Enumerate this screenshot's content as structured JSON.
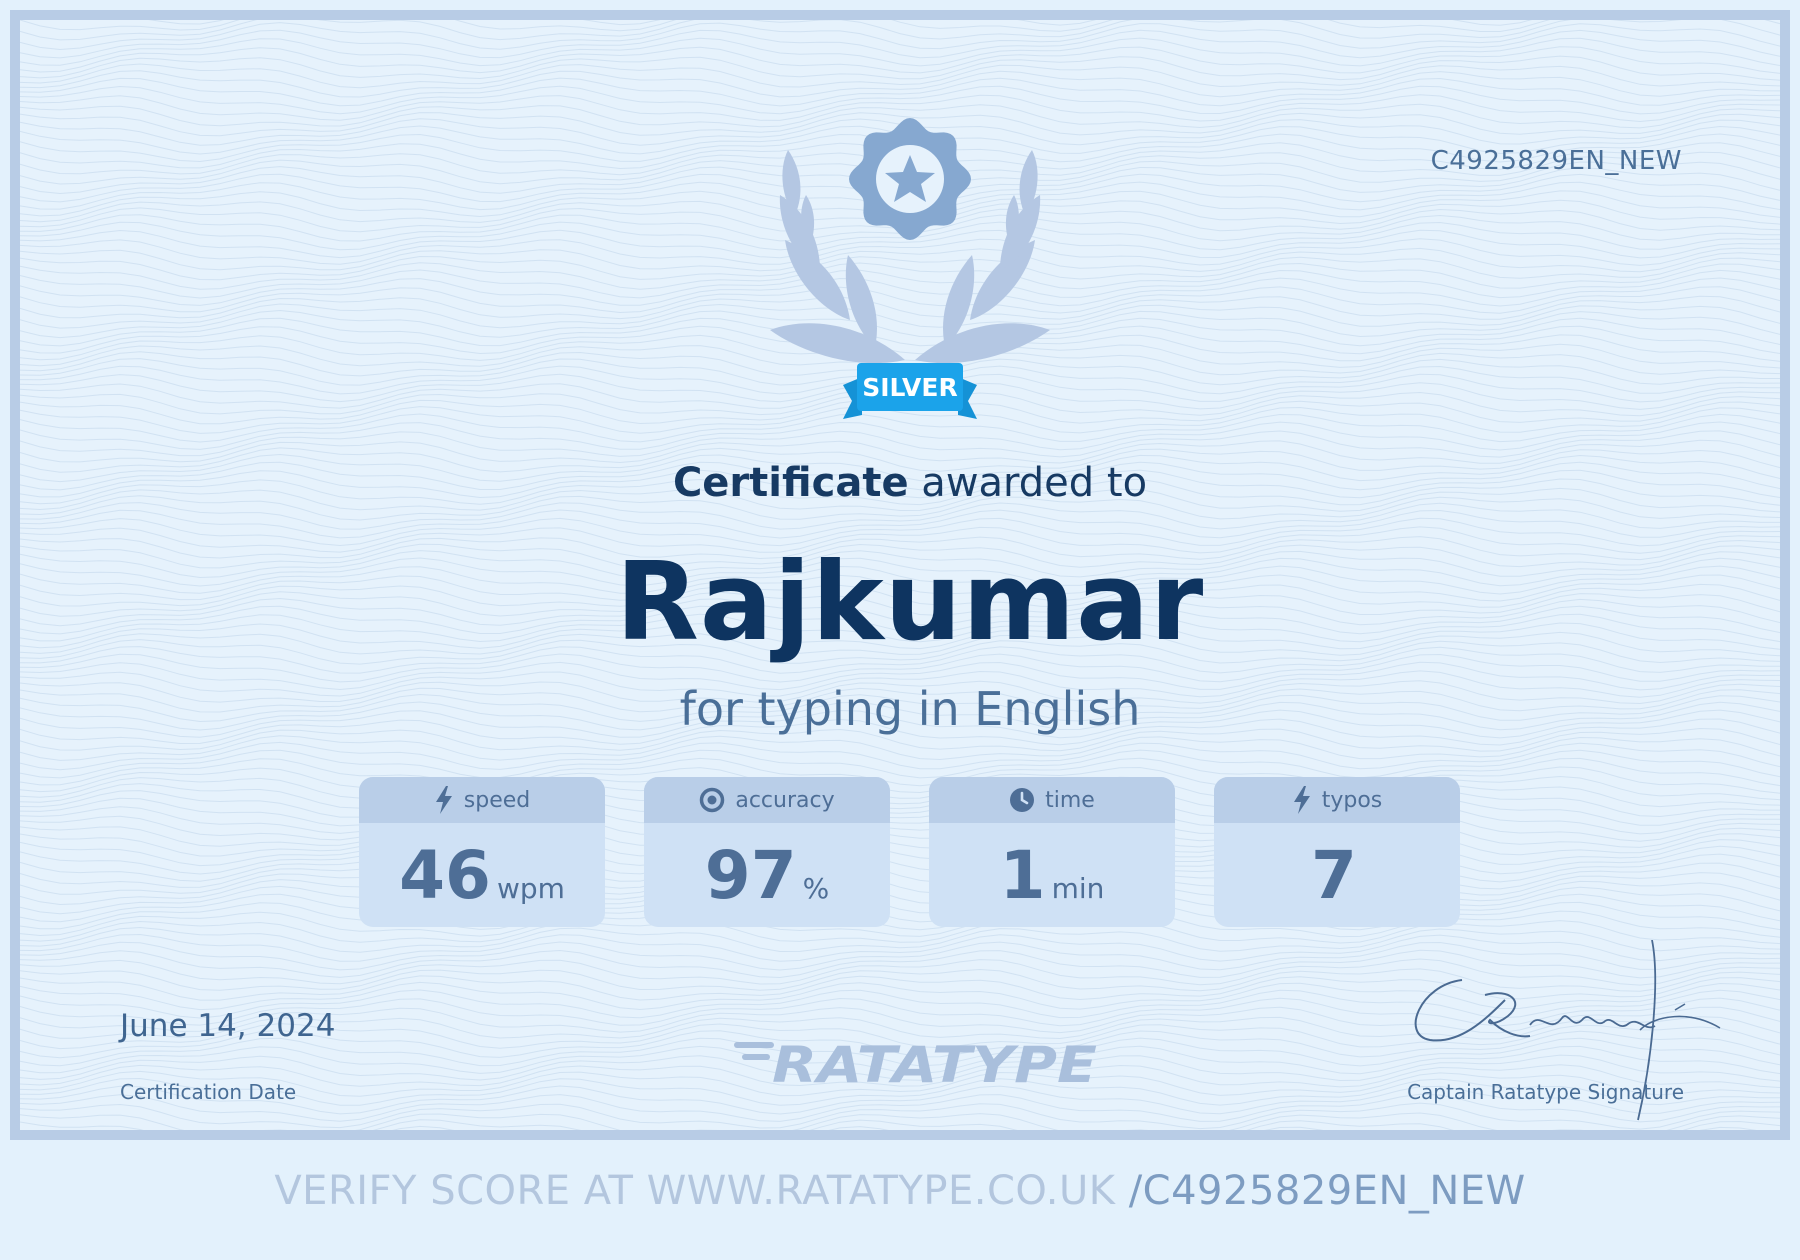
{
  "certificate": {
    "id": "C4925829EN_NEW",
    "badge_label": "SILVER",
    "heading_bold": "Certificate",
    "heading_rest": " awarded to",
    "recipient": "Rajkumar",
    "subtitle": "for typing in English"
  },
  "stats": [
    {
      "label": "speed",
      "value": "46",
      "unit": "wpm",
      "icon": "bolt-icon"
    },
    {
      "label": "accuracy",
      "value": "97",
      "unit": "%",
      "icon": "target-icon"
    },
    {
      "label": "time",
      "value": "1",
      "unit": "min",
      "icon": "clock-icon"
    },
    {
      "label": "typos",
      "value": "7",
      "unit": "",
      "icon": "bolt-icon"
    }
  ],
  "footer": {
    "date": "June 14, 2024",
    "date_label": "Certification Date",
    "brand": "RATATYPE",
    "signature_text": "CRatatype",
    "signature_label": "Captain Ratatype Signature"
  },
  "verify": {
    "prefix": "VERIFY SCORE AT WWW.RATATYPE.CO.UK ",
    "code": "/C4925829EN_NEW"
  },
  "colors": {
    "background": "#e6f2fc",
    "border": "#b8cce6",
    "name": "#0e3460",
    "accent_ribbon": "#1ba3ea",
    "stat_card": "#cfe1f5",
    "stat_header": "#b9cee8"
  }
}
